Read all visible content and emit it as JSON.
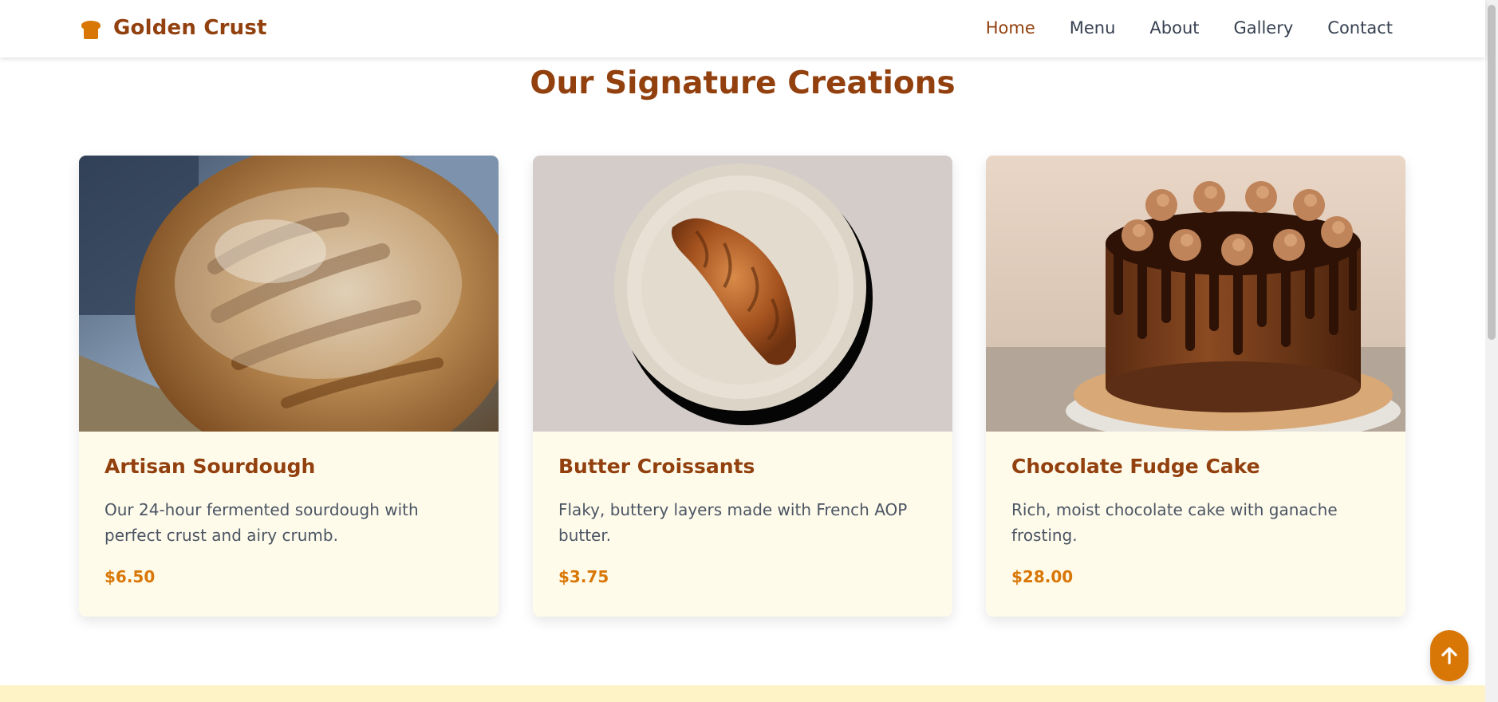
{
  "brand": {
    "name": "Golden Crust",
    "icon": "bread-icon"
  },
  "nav": {
    "items": [
      {
        "label": "Home",
        "active": true
      },
      {
        "label": "Menu",
        "active": false
      },
      {
        "label": "About",
        "active": false
      },
      {
        "label": "Gallery",
        "active": false
      },
      {
        "label": "Contact",
        "active": false
      }
    ]
  },
  "section": {
    "title": "Our Signature Creations"
  },
  "products": [
    {
      "name": "Artisan Sourdough",
      "description": "Our 24-hour fermented sourdough with perfect crust and airy crumb.",
      "price": "$6.50",
      "image": "sourdough-loaf-photo"
    },
    {
      "name": "Butter Croissants",
      "description": "Flaky, buttery layers made with French AOP butter.",
      "price": "$3.75",
      "image": "croissant-on-plate-photo"
    },
    {
      "name": "Chocolate Fudge Cake",
      "description": "Rich, moist chocolate cake with ganache frosting.",
      "price": "$28.00",
      "image": "chocolate-drip-cake-photo"
    }
  ],
  "back_to_top": {
    "icon": "arrow-up-icon"
  },
  "colors": {
    "brand_brown": "#92400e",
    "accent_amber": "#d97706",
    "card_background": "#fefbeb",
    "body_text": "#4b5563",
    "footer_background": "#fef3c7"
  }
}
